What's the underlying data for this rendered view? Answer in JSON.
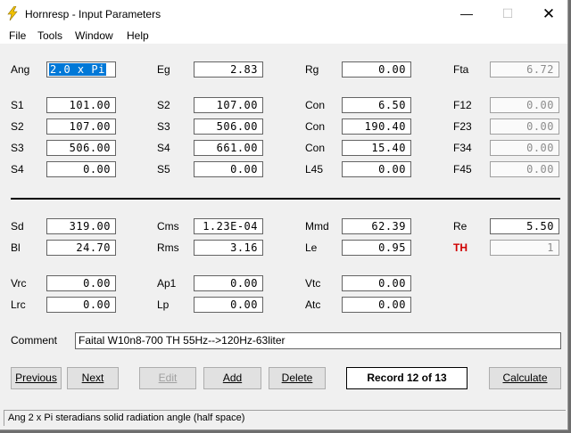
{
  "window": {
    "title": "Hornresp - Input Parameters",
    "min": "—",
    "max": "☐",
    "close": "✕"
  },
  "menu": [
    "File",
    "Tools",
    "Window",
    "Help"
  ],
  "params": {
    "ang": {
      "label": "Ang",
      "value": "2.0 x Pi"
    },
    "eg": {
      "label": "Eg",
      "value": "2.83"
    },
    "rg": {
      "label": "Rg",
      "value": "0.00"
    },
    "fta": {
      "label": "Fta",
      "value": "6.72"
    },
    "s1": {
      "label": "S1",
      "value": "101.00"
    },
    "s2_left": {
      "label": "S2",
      "value": "107.00"
    },
    "s3_left": {
      "label": "S3",
      "value": "506.00"
    },
    "s4_left": {
      "label": "S4",
      "value": "0.00"
    },
    "s2": {
      "label": "S2",
      "value": "107.00"
    },
    "s3": {
      "label": "S3",
      "value": "506.00"
    },
    "s4": {
      "label": "S4",
      "value": "661.00"
    },
    "s5": {
      "label": "S5",
      "value": "0.00"
    },
    "con1": {
      "label": "Con",
      "value": "6.50"
    },
    "con2": {
      "label": "Con",
      "value": "190.40"
    },
    "con3": {
      "label": "Con",
      "value": "15.40"
    },
    "l45": {
      "label": "L45",
      "value": "0.00"
    },
    "f12": {
      "label": "F12",
      "value": "0.00"
    },
    "f23": {
      "label": "F23",
      "value": "0.00"
    },
    "f34": {
      "label": "F34",
      "value": "0.00"
    },
    "f45": {
      "label": "F45",
      "value": "0.00"
    },
    "sd": {
      "label": "Sd",
      "value": "319.00"
    },
    "bl": {
      "label": "Bl",
      "value": "24.70"
    },
    "cms": {
      "label": "Cms",
      "value": "1.23E-04"
    },
    "rms": {
      "label": "Rms",
      "value": "3.16"
    },
    "mmd": {
      "label": "Mmd",
      "value": "62.39"
    },
    "le": {
      "label": "Le",
      "value": "0.95"
    },
    "re": {
      "label": "Re",
      "value": "5.50"
    },
    "th": {
      "label": "TH",
      "value": "1"
    },
    "vrc": {
      "label": "Vrc",
      "value": "0.00"
    },
    "lrc": {
      "label": "Lrc",
      "value": "0.00"
    },
    "ap1": {
      "label": "Ap1",
      "value": "0.00"
    },
    "lp": {
      "label": "Lp",
      "value": "0.00"
    },
    "vtc": {
      "label": "Vtc",
      "value": "0.00"
    },
    "atc": {
      "label": "Atc",
      "value": "0.00"
    }
  },
  "comment": {
    "label": "Comment",
    "value": "Faital W10n8-700 TH 55Hz-->120Hz-63liter"
  },
  "buttons": {
    "previous": "Previous",
    "next": "Next",
    "edit": "Edit",
    "add": "Add",
    "delete": "Delete",
    "calculate": "Calculate"
  },
  "record": "Record 12 of 13",
  "status": "Ang   2 x Pi steradians solid radiation angle  (half space)",
  "colors": {
    "selection": "#0078d7",
    "th_label": "#d00000",
    "icon": "#f2c200"
  }
}
